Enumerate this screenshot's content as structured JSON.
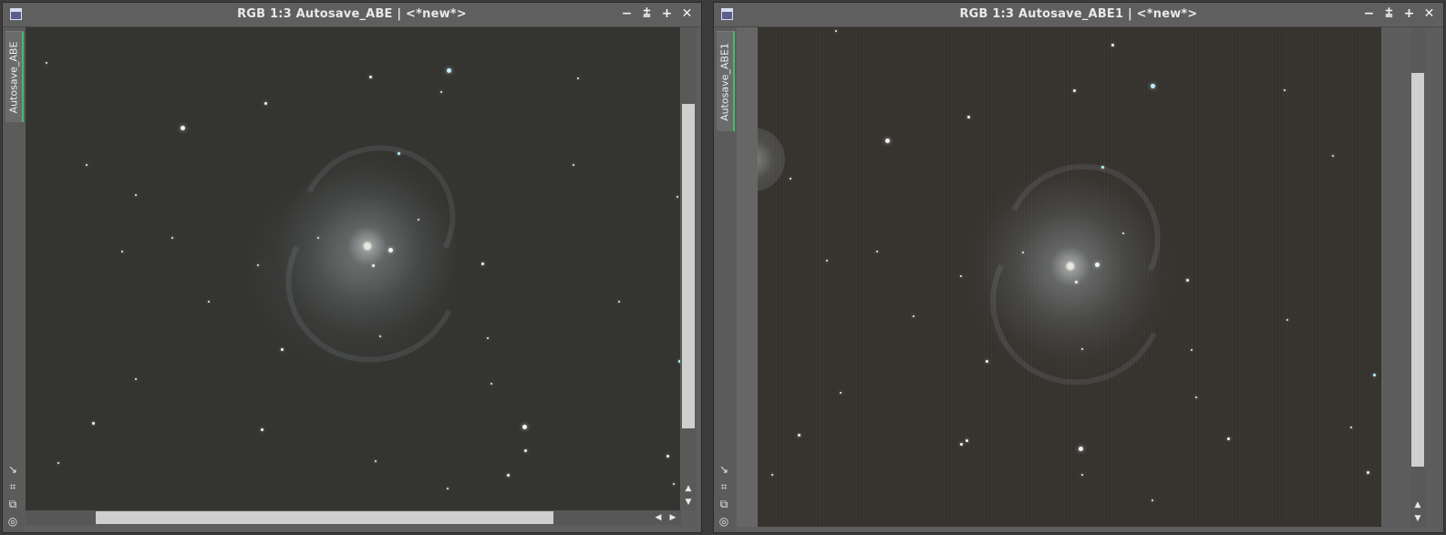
{
  "windows": [
    {
      "title": "RGB 1:3 Autosave_ABE | <*new*>",
      "tab_label": "Autosave_ABE",
      "buttons": [
        "minimize-icon",
        "shade-icon",
        "maximize-icon",
        "close-icon"
      ],
      "side_icons": [
        "arrow-icon",
        "zoom-fit-icon",
        "copy-icon",
        "target-icon"
      ]
    },
    {
      "title": "RGB 1:3 Autosave_ABE1 | <*new*>",
      "tab_label": "Autosave_ABE1",
      "buttons": [
        "minimize-icon",
        "shade-icon",
        "maximize-icon",
        "close-icon"
      ],
      "side_icons": [
        "arrow-icon",
        "zoom-fit-icon",
        "copy-icon",
        "target-icon"
      ]
    }
  ],
  "glyphs": {
    "minimize": "−",
    "shade": "⩲",
    "maximize": "+",
    "close": "✕",
    "arrow": "↘",
    "zoom_fit": "⌗",
    "copy": "⧉",
    "target": "◎",
    "up": "▲",
    "down": "▼",
    "left": "◀",
    "right": "▶"
  },
  "colors": {
    "tab_accent": "#3fbf6a",
    "window_frame": "#5d5d5d",
    "image_bg": "#343431"
  }
}
